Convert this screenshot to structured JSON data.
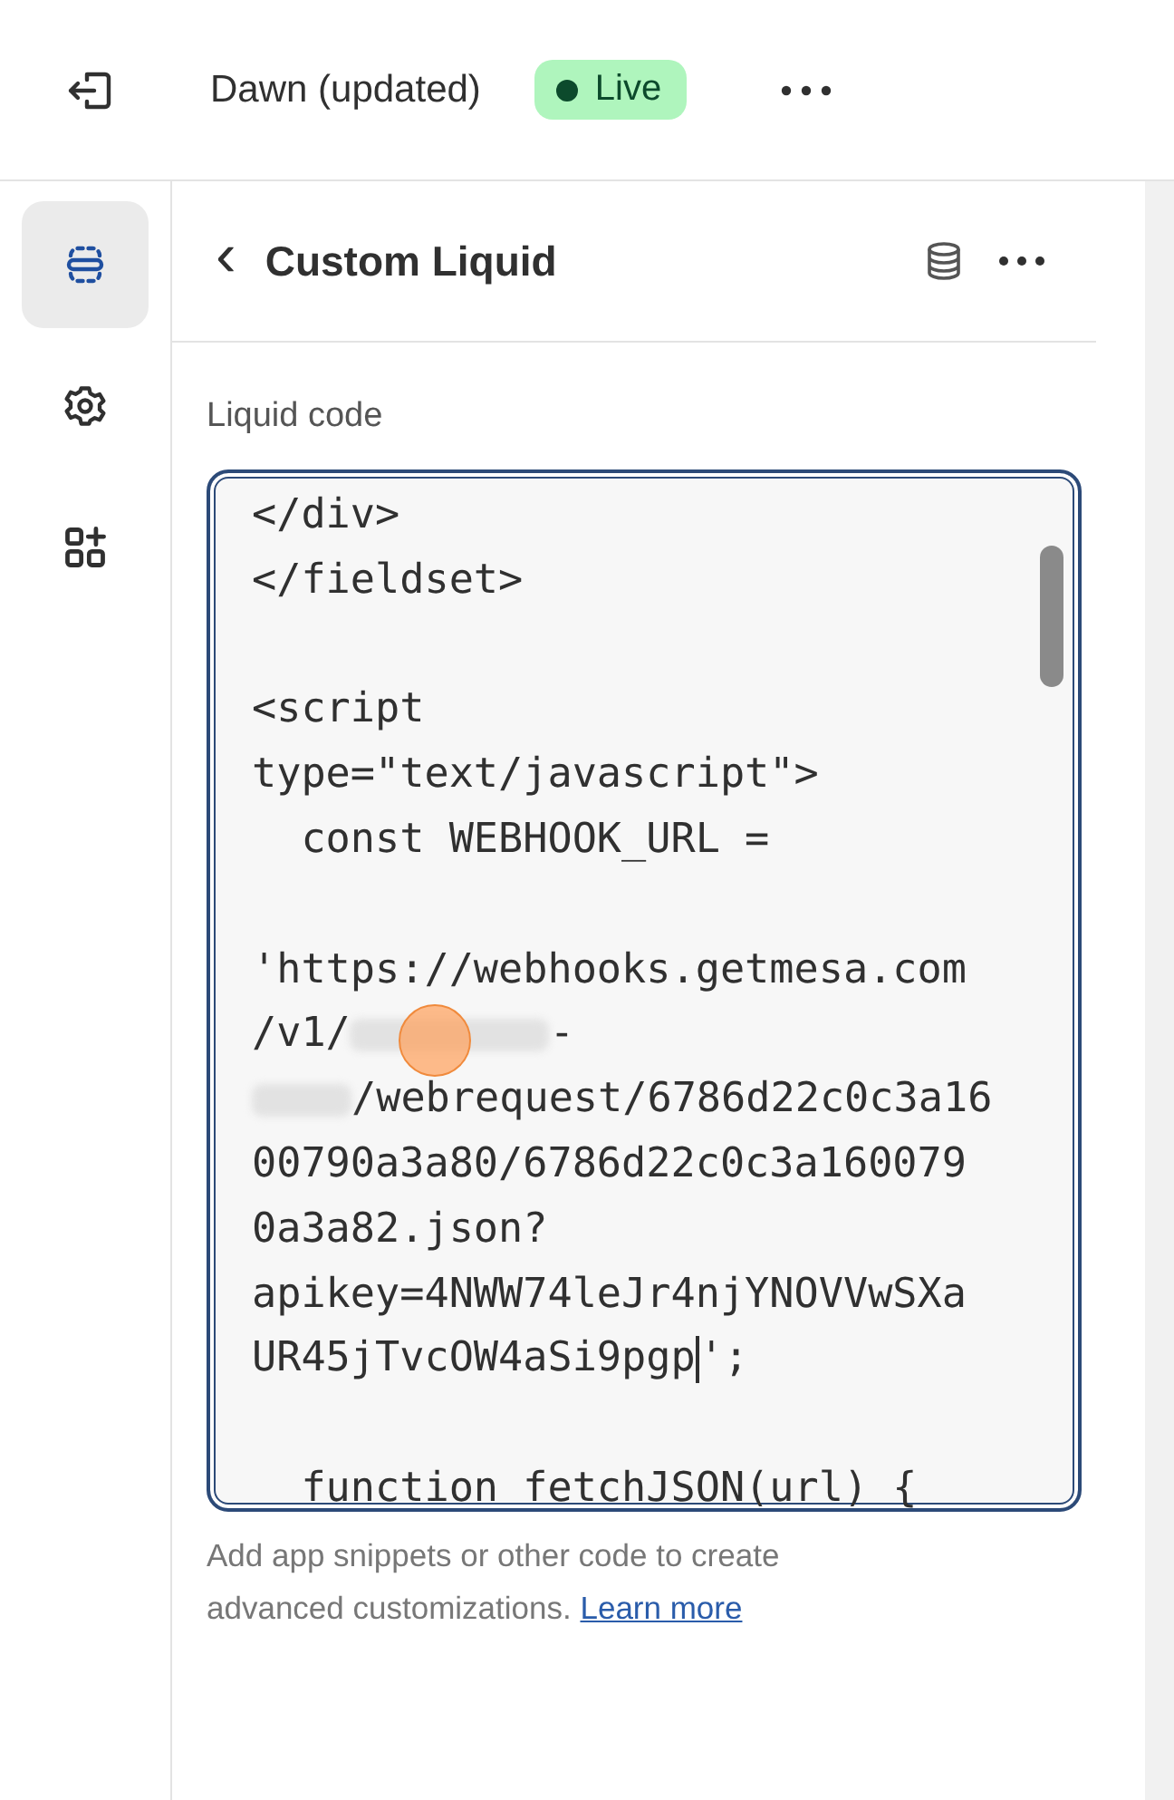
{
  "topbar": {
    "theme_name": "Dawn (updated)",
    "status": {
      "label": "Live",
      "kind": "live"
    }
  },
  "rail": [
    {
      "kind": "sections",
      "selected": true
    },
    {
      "kind": "settings",
      "selected": false
    },
    {
      "kind": "apps",
      "selected": false
    }
  ],
  "panel": {
    "back": "‹",
    "title": "Custom Liquid",
    "field": {
      "label": "Liquid code",
      "lines": [
        [
          {
            "kind": "text",
            "text": "</div>"
          }
        ],
        [
          {
            "kind": "text",
            "text": "</fieldset>"
          }
        ],
        [
          {
            "kind": "blank"
          }
        ],
        [
          {
            "kind": "text",
            "text": "<script"
          }
        ],
        [
          {
            "kind": "text",
            "text": "type=\"text/javascript\">"
          }
        ],
        [
          {
            "kind": "text",
            "text": "  const WEBHOOK_URL ="
          }
        ],
        [
          {
            "kind": "blank"
          }
        ],
        [
          {
            "kind": "text",
            "text": "'https://webhooks.getmesa.com"
          }
        ],
        [
          {
            "kind": "text",
            "text": "/v1/"
          },
          {
            "kind": "redacted"
          },
          {
            "kind": "text",
            "text": "-"
          }
        ],
        [
          {
            "kind": "redacted"
          },
          {
            "kind": "text",
            "text": "/webrequest/6786d22c0c3a16"
          }
        ],
        [
          {
            "kind": "text",
            "text": "00790a3a80/6786d22c0c3a160079"
          }
        ],
        [
          {
            "kind": "text",
            "text": "0a3a82.json?"
          }
        ],
        [
          {
            "kind": "text",
            "text": "apikey=4NWW74leJr4njYNOVVwSXa"
          }
        ],
        [
          {
            "kind": "text",
            "text": "UR45jTvcOW4aSi9pgp"
          },
          {
            "kind": "caret"
          },
          {
            "kind": "text",
            "text": "';"
          }
        ],
        [
          {
            "kind": "blank"
          }
        ],
        [
          {
            "kind": "text",
            "text": "  function fetchJSON(url) {"
          }
        ]
      ],
      "help": "Add app snippets or other code to create advanced customizations.",
      "link": "Learn more"
    }
  },
  "click_marker": true
}
